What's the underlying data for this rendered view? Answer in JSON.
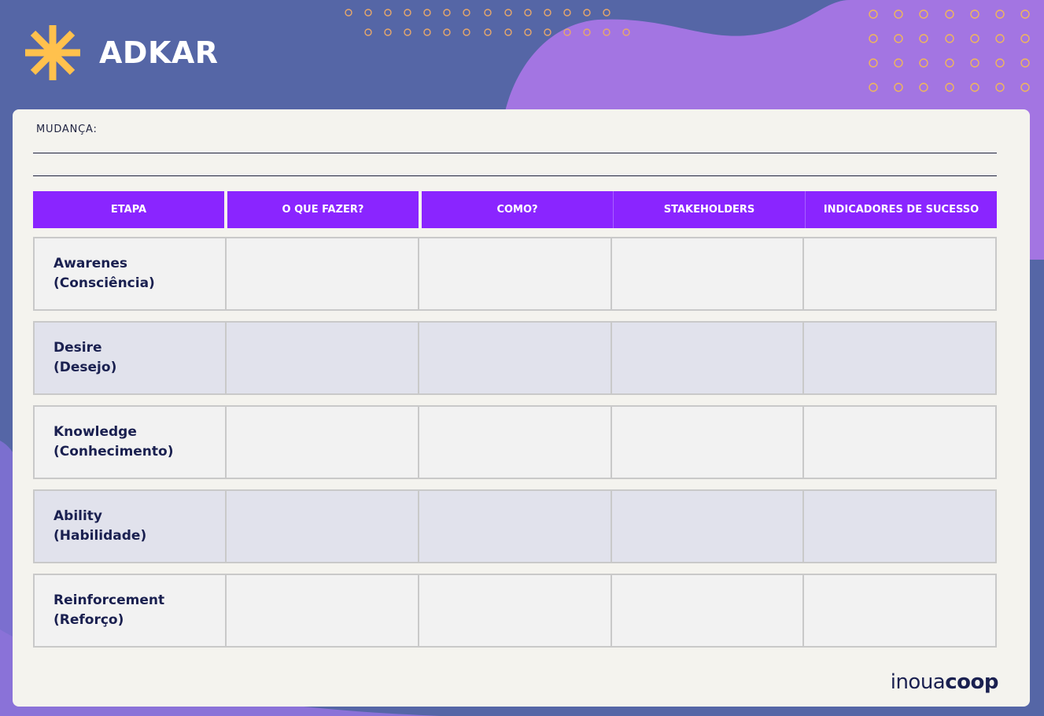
{
  "header": {
    "title": "ADKAR"
  },
  "form": {
    "change_label": "MUDANÇA:"
  },
  "table": {
    "columns": [
      "ETAPA",
      "O QUE FAZER?",
      "COMO?",
      "STAKEHOLDERS",
      "INDICADORES DE SUCESSO"
    ],
    "rows": [
      {
        "stage": "Awarenes",
        "translation": "(Consciência)"
      },
      {
        "stage": "Desire",
        "translation": "(Desejo)"
      },
      {
        "stage": "Knowledge",
        "translation": "(Conhecimento)"
      },
      {
        "stage": "Ability",
        "translation": "(Habilidade)"
      },
      {
        "stage": "Reinforcement",
        "translation": "(Reforço)"
      }
    ]
  },
  "footer": {
    "brand_light": "inoua",
    "brand_bold": "coop"
  },
  "colors": {
    "background_blue": "#5566a6",
    "blob_purple": "#a375e2",
    "accent_yellow": "#ffc14d",
    "header_purple": "#8a25ff",
    "text_navy": "#1a2050",
    "card": "#f4f3ee"
  },
  "icons": {
    "logo": "asterisk-icon"
  }
}
